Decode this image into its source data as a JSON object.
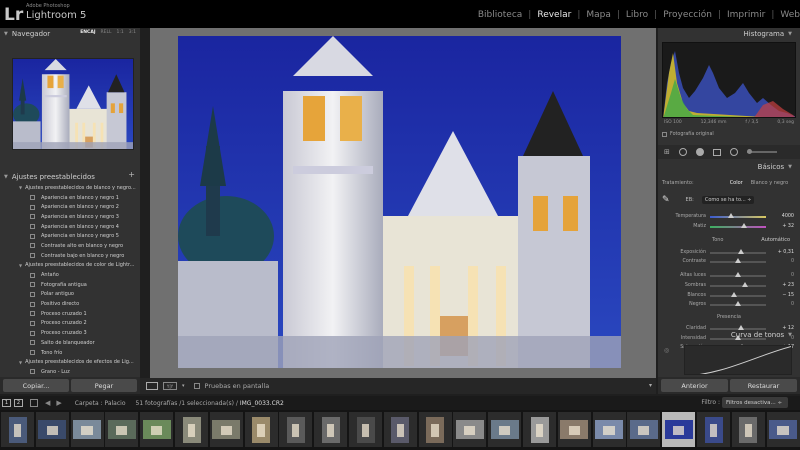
{
  "app": {
    "brand_small": "Adobe Photoshop",
    "brand_name": "Lightroom 5",
    "logo": "Lr"
  },
  "modules": [
    {
      "label": "Biblioteca",
      "active": false
    },
    {
      "label": "Revelar",
      "active": true
    },
    {
      "label": "Mapa",
      "active": false
    },
    {
      "label": "Libro",
      "active": false
    },
    {
      "label": "Proyección",
      "active": false
    },
    {
      "label": "Imprimir",
      "active": false
    },
    {
      "label": "Web",
      "active": false
    }
  ],
  "navigator": {
    "title": "Navegador",
    "zoom": [
      "ENCAJ",
      "RELL",
      "1:1",
      "3:1"
    ]
  },
  "presets": {
    "title": "Ajustes preestablecidos",
    "add": "+",
    "rows": [
      {
        "type": "folder",
        "label": "Ajustes preestablecidos de blanco y negro..."
      },
      {
        "type": "item",
        "label": "Apariencia en blanco y negro 1"
      },
      {
        "type": "item",
        "label": "Apariencia en blanco y negro 2"
      },
      {
        "type": "item",
        "label": "Apariencia en blanco y negro 3"
      },
      {
        "type": "item",
        "label": "Apariencia en blanco y negro 4"
      },
      {
        "type": "item",
        "label": "Apariencia en blanco y negro 5"
      },
      {
        "type": "item",
        "label": "Contraste alto en blanco y negro"
      },
      {
        "type": "item",
        "label": "Contraste bajo en blanco y negro"
      },
      {
        "type": "folder",
        "label": "Ajustes preestablecidos de color de Lightr..."
      },
      {
        "type": "item",
        "label": "Antaño"
      },
      {
        "type": "item",
        "label": "Fotografía antigua"
      },
      {
        "type": "item",
        "label": "Polar antiguo"
      },
      {
        "type": "item",
        "label": "Positivo directo"
      },
      {
        "type": "item",
        "label": "Proceso cruzado 1"
      },
      {
        "type": "item",
        "label": "Proceso cruzado 2"
      },
      {
        "type": "item",
        "label": "Proceso cruzado 3"
      },
      {
        "type": "item",
        "label": "Salto de blanqueador"
      },
      {
        "type": "item",
        "label": "Tono frío"
      },
      {
        "type": "folder",
        "label": "Ajustes preestablecidos de efectos de Lig..."
      },
      {
        "type": "item",
        "label": "Grano - Luz"
      }
    ]
  },
  "left_buttons": {
    "copy": "Copiar...",
    "paste": "Pegar"
  },
  "toolbar": {
    "proof_label": "Pruebas en pantalla"
  },
  "histogram": {
    "title": "Histograma",
    "iso": "ISO 100",
    "focal": "12,346 mm",
    "aperture": "f / 3,5",
    "shutter": "0,3 seg",
    "original_photo": "Fotografía original"
  },
  "basics": {
    "title": "Básicos",
    "treatment_label": "Tratamiento:",
    "treatment_color": "Color",
    "treatment_bw": "Blanco y negro",
    "wb_label": "EB:",
    "wb_value": "Como se ha to... ÷",
    "tone_label": "Tono",
    "auto_label": "Automático",
    "presence_label": "Presencia",
    "sliders": [
      {
        "label": "Temperatura",
        "value": "4000",
        "pos": 0.38,
        "section": "wb"
      },
      {
        "label": "Matiz",
        "value": "+ 32",
        "pos": 0.6,
        "section": "wb"
      },
      {
        "label": "Exposición",
        "value": "+ 0,31",
        "pos": 0.55,
        "section": "tone"
      },
      {
        "label": "Contraste",
        "value": "0",
        "pos": 0.5,
        "section": "tone"
      },
      {
        "label": "Altas luces",
        "value": "0",
        "pos": 0.5,
        "section": "tone2"
      },
      {
        "label": "Sombras",
        "value": "+ 23",
        "pos": 0.62,
        "section": "tone2"
      },
      {
        "label": "Blancos",
        "value": "− 15",
        "pos": 0.42,
        "section": "tone2"
      },
      {
        "label": "Negros",
        "value": "0",
        "pos": 0.5,
        "section": "tone2"
      },
      {
        "label": "Claridad",
        "value": "+ 12",
        "pos": 0.56,
        "section": "presence"
      },
      {
        "label": "Intensidad",
        "value": "0",
        "pos": 0.5,
        "section": "presence"
      },
      {
        "label": "Saturación",
        "value": "+ 17",
        "pos": 0.58,
        "section": "presence"
      }
    ]
  },
  "tone_curve": {
    "title": "Curva de tonos"
  },
  "right_buttons": {
    "previous": "Anterior",
    "reset": "Restaurar"
  },
  "filmstrip": {
    "screen1": "1",
    "screen2": "2",
    "folder": "Carpeta : Palacio",
    "count": "51 fotografías /1 seleccionada(s) /",
    "file": "IMG_0033.CR2",
    "filter_label": "Filtro :",
    "filter_value": "Filtros desactiva... ÷",
    "selected_index": 19
  },
  "colors": {
    "accent_active": "#e8e8e8",
    "sky": "#1b2a8c"
  }
}
